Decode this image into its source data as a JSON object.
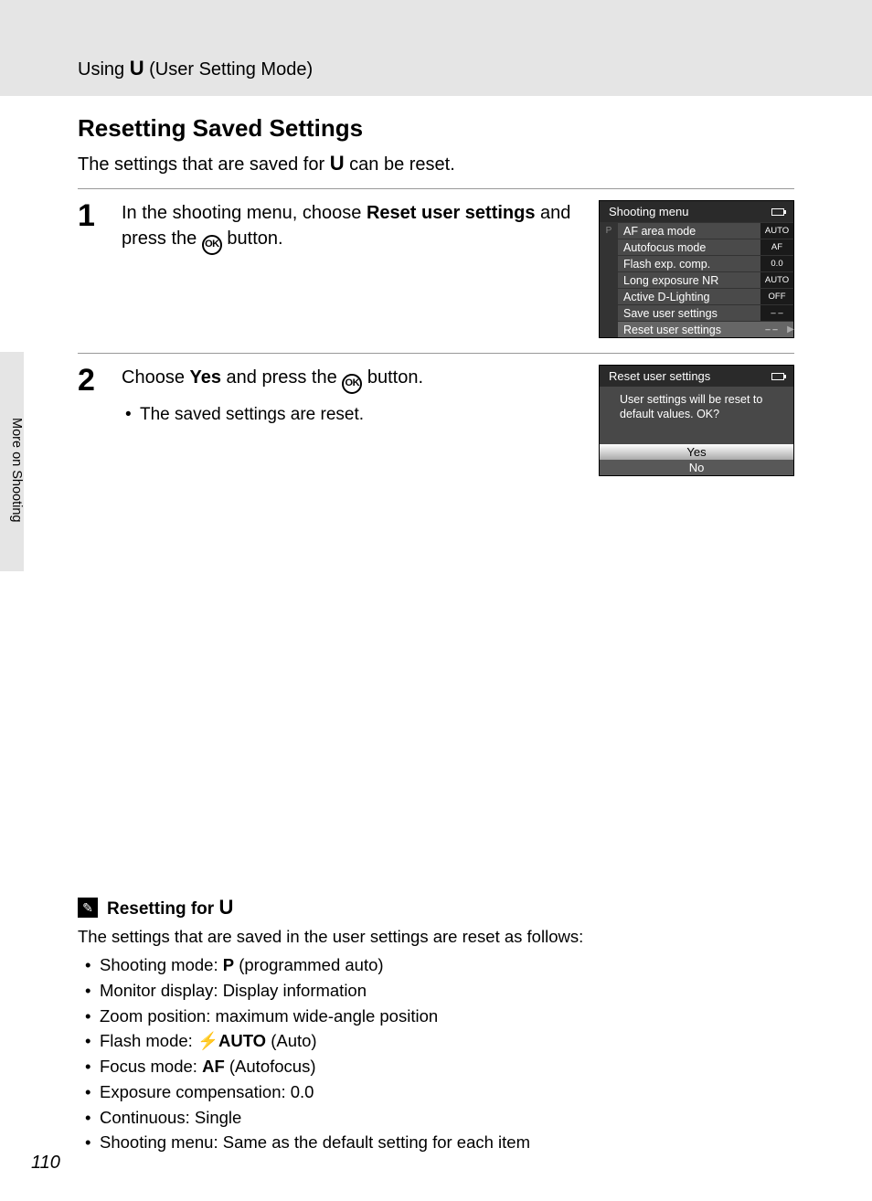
{
  "header": {
    "breadcrumb_prefix": "Using ",
    "breadcrumb_icon": "U",
    "breadcrumb_suffix": " (User Setting Mode)"
  },
  "title": "Resetting Saved Settings",
  "intro_prefix": "The settings that are saved for ",
  "intro_icon": "U",
  "intro_suffix": " can be reset.",
  "side_tab": "More on Shooting",
  "page_number": "110",
  "steps": [
    {
      "num": "1",
      "text_a": "In the shooting menu, choose ",
      "text_b": "Reset user settings",
      "text_c": " and press the ",
      "text_d": " button.",
      "ok": "OK",
      "lcd_title": "Shooting menu",
      "rows": [
        {
          "label": "AF area mode",
          "val": "AUTO",
          "left": "P"
        },
        {
          "label": "Autofocus mode",
          "val": "AF",
          "left": ""
        },
        {
          "label": "Flash exp. comp.",
          "val": "0.0",
          "left": ""
        },
        {
          "label": "Long exposure NR",
          "val": "AUTO",
          "left": ""
        },
        {
          "label": "Active D-Lighting",
          "val": "OFF",
          "left": ""
        },
        {
          "label": "Save user settings",
          "val": "– –",
          "left": ""
        },
        {
          "label": "Reset user settings",
          "val": "– –",
          "left": "",
          "selected": true
        }
      ]
    },
    {
      "num": "2",
      "text_a": "Choose ",
      "text_b": "Yes",
      "text_c": " and press the ",
      "text_d": " button.",
      "ok": "OK",
      "bullet": "The saved settings are reset.",
      "lcd_title": "Reset user settings",
      "lcd_msg": "User settings will be reset to default values. OK?",
      "yes": "Yes",
      "no": "No"
    }
  ],
  "note": {
    "heading_prefix": "Resetting for ",
    "heading_icon": "U",
    "intro": "The settings that are saved in the user settings are reset as follows:",
    "items": [
      {
        "pre": "Shooting mode: ",
        "icon": "P",
        "post": " (programmed auto)"
      },
      {
        "pre": "Monitor display: Display information",
        "icon": "",
        "post": ""
      },
      {
        "pre": "Zoom position: maximum wide-angle position",
        "icon": "",
        "post": ""
      },
      {
        "pre": "Flash mode: ",
        "icon": "⚡AUTO",
        "post": " (Auto)"
      },
      {
        "pre": "Focus mode: ",
        "icon": "AF",
        "post": " (Autofocus)"
      },
      {
        "pre": "Exposure compensation: 0.0",
        "icon": "",
        "post": ""
      },
      {
        "pre": "Continuous: Single",
        "icon": "",
        "post": ""
      },
      {
        "pre": "Shooting menu: Same as the default setting for each item",
        "icon": "",
        "post": ""
      }
    ]
  }
}
